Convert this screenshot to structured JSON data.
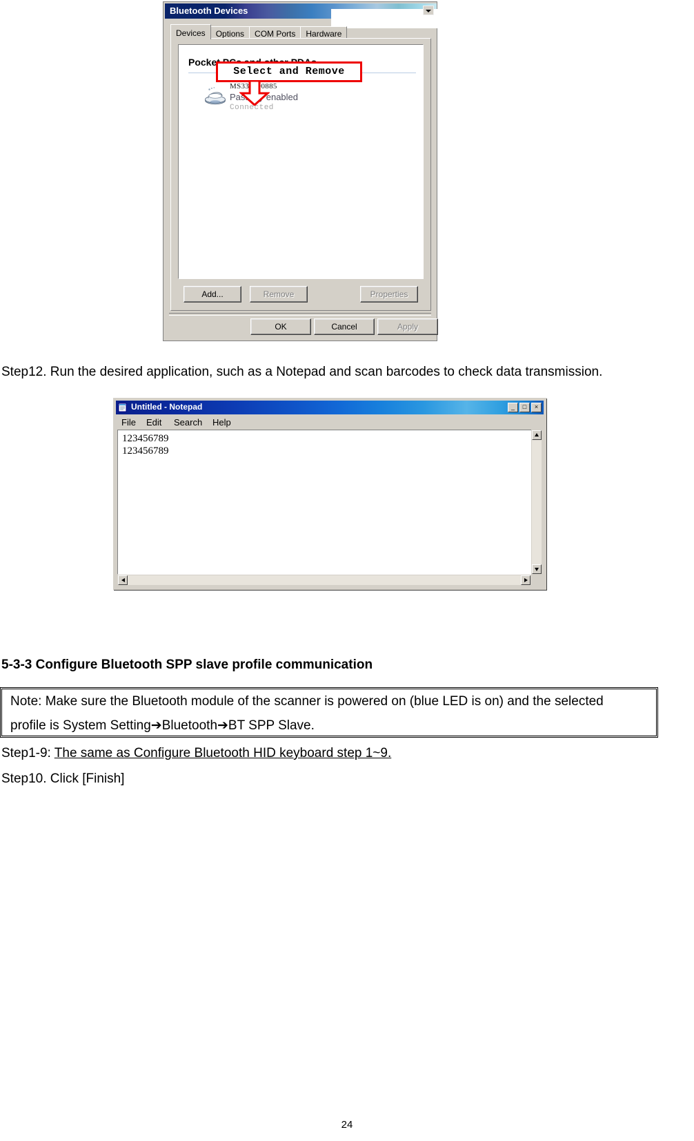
{
  "bluetooth_dialog": {
    "title": "Bluetooth Devices",
    "tabs": [
      {
        "label": "Devices",
        "active": true
      },
      {
        "label": "Options",
        "active": false
      },
      {
        "label": "COM Ports",
        "active": false
      },
      {
        "label": "Hardware",
        "active": false
      }
    ],
    "group_header": "Pocket PCs and other PDAs",
    "device": {
      "name": "MS339890885",
      "status": "Passkey enabled",
      "connection": "Connected"
    },
    "annotation": {
      "text": "Select and Remove",
      "box_color": "#ee0000",
      "arrow_color": "#ee0000"
    },
    "buttons": {
      "add": "Add...",
      "remove": "Remove",
      "properties": "Properties",
      "ok": "OK",
      "cancel": "Cancel",
      "apply": "Apply"
    }
  },
  "step12_text": "Step12. Run the desired application, such as a Notepad and scan barcodes to check data transmission.",
  "notepad": {
    "title": "Untitled - Notepad",
    "menus": [
      "File",
      "Edit",
      "Search",
      "Help"
    ],
    "controls": {
      "minimize": "_",
      "maximize": "□",
      "close": "×"
    },
    "content_lines": [
      "123456789",
      "123456789"
    ]
  },
  "section": {
    "heading": "5-3-3 Configure Bluetooth SPP slave profile communication"
  },
  "note": {
    "line1": "Note: Make sure the Bluetooth module of the scanner is powered on (blue LED is on) and the selected",
    "line2": "profile is System Setting➔Bluetooth➔BT SPP Slave."
  },
  "steps": {
    "step1_9_prefix": "Step1-9: ",
    "step1_9_underlined": "The same as Configure Bluetooth HID keyboard step 1~9.",
    "step10": "Step10. Click [Finish]"
  },
  "page_number": "24"
}
